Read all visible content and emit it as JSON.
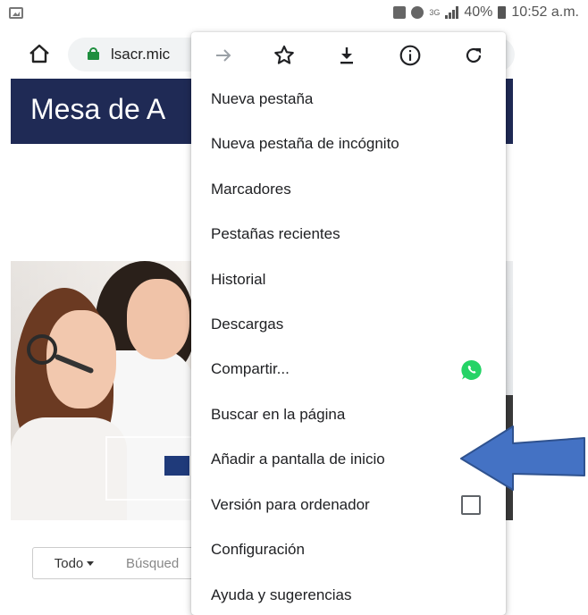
{
  "status_bar": {
    "network": "3G",
    "battery": "40%",
    "time": "10:52 a.m."
  },
  "address_bar": {
    "url": "lsacr.mic"
  },
  "page": {
    "title": "Mesa de A",
    "search_dropdown_label": "Todo",
    "search_placeholder": "Búsqued"
  },
  "menu": {
    "icons": [
      "forward-arrow-icon",
      "star-icon",
      "download-icon",
      "info-icon",
      "reload-icon"
    ],
    "items": [
      "Nueva pestaña",
      "Nueva pestaña de incógnito",
      "Marcadores",
      "Pestañas recientes",
      "Historial",
      "Descargas",
      "Compartir...",
      "Buscar en la página",
      "Añadir a pantalla de inicio",
      "Versión para ordenador",
      "Configuración",
      "Ayuda y sugerencias"
    ]
  },
  "colors": {
    "header_navy": "#1f2a55",
    "lock_green": "#1e8e3e",
    "whatsapp_green": "#25d366",
    "arrow_blue": "#4472c4"
  }
}
